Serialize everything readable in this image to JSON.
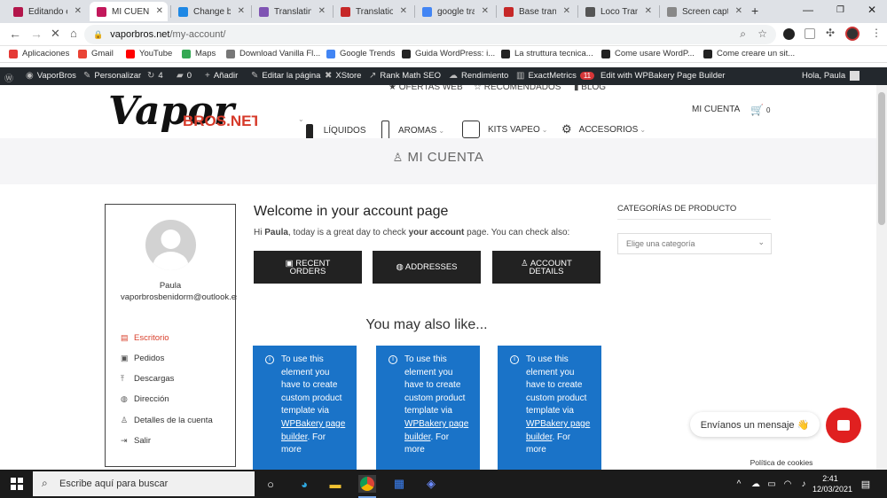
{
  "browser": {
    "tabs": [
      {
        "title": "Editando es",
        "icon": "wordpress-icon",
        "color": "#b3164b"
      },
      {
        "title": "MI CUENTA",
        "icon": "vaporbros-icon",
        "color": "#c2185b",
        "active": true
      },
      {
        "title": "Change bul",
        "icon": "blue-doc-icon",
        "color": "#1e88e5"
      },
      {
        "title": "Translating",
        "icon": "woocommerce-icon",
        "color": "#7f54b3"
      },
      {
        "title": "Translation",
        "icon": "x-icon",
        "color": "#c62828"
      },
      {
        "title": "google tran",
        "icon": "google-icon",
        "color": "#4285f4"
      },
      {
        "title": "Base transl",
        "icon": "x-icon",
        "color": "#c62828"
      },
      {
        "title": "Loco Transl",
        "icon": "wordpress-icon",
        "color": "#555555"
      },
      {
        "title": "Screen capt",
        "icon": "dot-icon",
        "color": "#888888"
      }
    ],
    "url_domain": "vaporbros.net",
    "url_path": "/my-account/",
    "bookmarks": [
      {
        "label": "Aplicaciones",
        "icon": "apps-grid-icon",
        "color": "#e53935"
      },
      {
        "label": "Gmail",
        "icon": "gmail-icon",
        "color": "#ea4335"
      },
      {
        "label": "YouTube",
        "icon": "youtube-icon",
        "color": "#ff0000"
      },
      {
        "label": "Maps",
        "icon": "maps-pin-icon",
        "color": "#34a853"
      },
      {
        "label": "Download Vanilla Fl...",
        "icon": "globe-icon",
        "color": "#777777"
      },
      {
        "label": "Google Trends",
        "icon": "trends-icon",
        "color": "#4285f4"
      },
      {
        "label": "Guida WordPress: i...",
        "icon": "seo-icon",
        "color": "#222222"
      },
      {
        "label": "La struttura tecnica...",
        "icon": "seo-icon",
        "color": "#222222"
      },
      {
        "label": "Come usare WordP...",
        "icon": "seo-icon",
        "color": "#222222"
      },
      {
        "label": "Come creare un sit...",
        "icon": "seo-icon",
        "color": "#222222"
      }
    ]
  },
  "adminbar": {
    "items": [
      {
        "label": "",
        "icon": "wp-logo-icon"
      },
      {
        "label": "VaporBros",
        "icon": "dashboard-icon"
      },
      {
        "label": "Personalizar",
        "icon": "brush-icon"
      },
      {
        "label": "4",
        "icon": "refresh-icon"
      },
      {
        "label": "0",
        "icon": "comment-icon"
      },
      {
        "label": "Añadir",
        "icon": "plus-icon"
      },
      {
        "label": "Editar la página",
        "icon": "pencil-icon"
      },
      {
        "label": "XStore",
        "icon": "xstore-icon"
      },
      {
        "label": "Rank Math SEO",
        "icon": "rankmath-icon"
      },
      {
        "label": "Rendimiento",
        "icon": "cloud-icon"
      },
      {
        "label": "ExactMetrics",
        "icon": "bars-icon"
      },
      {
        "label": "Edit with WPBakery Page Builder",
        "icon": ""
      }
    ],
    "exactmetrics_badge": "11",
    "greeting": "Hola, Paula"
  },
  "site": {
    "top_links": [
      "OFERTAS WEB",
      "RECOMENDADOS",
      "BLOG"
    ],
    "logo_main": "Vapor",
    "logo_sub": "BROS.NET",
    "menu": [
      "LÍQUIDOS",
      "AROMAS",
      "KITS VAPEO",
      "ACCESORIOS"
    ],
    "account_link": "MI CUENTA",
    "cart_count": "0",
    "banner_title": "MI CUENTA",
    "user": {
      "name": "Paula",
      "email": "vaporbrosbenidorm@outlook.es"
    },
    "account_nav": [
      {
        "label": "Escritorio",
        "icon": "dashboard-icon",
        "active": true
      },
      {
        "label": "Pedidos",
        "icon": "orders-icon"
      },
      {
        "label": "Descargas",
        "icon": "download-icon"
      },
      {
        "label": "Dirección",
        "icon": "globe-icon"
      },
      {
        "label": "Detalles de la cuenta",
        "icon": "user-icon"
      },
      {
        "label": "Salir",
        "icon": "logout-icon"
      }
    ],
    "welcome_title": "Welcome in your account page",
    "welcome_pre": "Hi ",
    "welcome_name": "Paula",
    "welcome_mid": ", today is a great day to check ",
    "welcome_bold": "your account",
    "welcome_post": " page. You can check also:",
    "buttons": [
      {
        "line1": "RECENT",
        "line2": "ORDERS",
        "icon": "calendar-icon"
      },
      {
        "line1": "ADDRESSES",
        "line2": "",
        "icon": "globe-icon"
      },
      {
        "line1": "ACCOUNT",
        "line2": "DETAILS",
        "icon": "user-icon"
      }
    ],
    "also_like": "You may also like...",
    "card_text_pre": "To use this element you have to create custom product template via",
    "card_link": "WPBakery page builder",
    "card_text_post": ". For more",
    "category_title": "CATEGORÍAS DE PRODUCTO",
    "category_placeholder": "Elige una categoría",
    "chat_text": "Envíanos un mensaje 👋",
    "cookie_text": "Política de cookies"
  },
  "taskbar": {
    "search_placeholder": "Escribe aquí para buscar",
    "time": "2:41",
    "date": "12/03/2021"
  }
}
